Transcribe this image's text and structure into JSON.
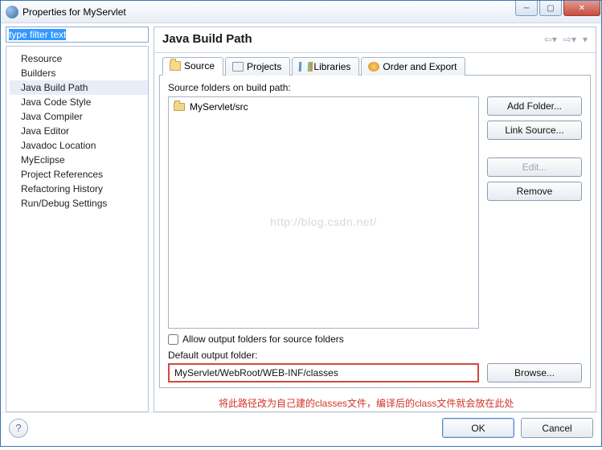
{
  "window": {
    "title": "Properties for MyServlet"
  },
  "sidebar": {
    "filter_placeholder": "type filter text",
    "items": [
      {
        "label": "Resource"
      },
      {
        "label": "Builders"
      },
      {
        "label": "Java Build Path"
      },
      {
        "label": "Java Code Style"
      },
      {
        "label": "Java Compiler"
      },
      {
        "label": "Java Editor"
      },
      {
        "label": "Javadoc Location"
      },
      {
        "label": "MyEclipse"
      },
      {
        "label": "Project References"
      },
      {
        "label": "Refactoring History"
      },
      {
        "label": "Run/Debug Settings"
      }
    ],
    "selected_index": 2
  },
  "main": {
    "heading": "Java Build Path",
    "tabs": [
      {
        "label": "Source"
      },
      {
        "label": "Projects"
      },
      {
        "label": "Libraries"
      },
      {
        "label": "Order and Export"
      }
    ],
    "active_tab": 0,
    "source_folders_label": "Source folders on build path:",
    "source_entries": [
      {
        "label": "MyServlet/src"
      }
    ],
    "buttons": {
      "add_folder": "Add Folder...",
      "link_source": "Link Source...",
      "edit": "Edit...",
      "remove": "Remove",
      "browse": "Browse..."
    },
    "allow_output_label": "Allow output folders for source folders",
    "allow_output_checked": false,
    "default_output_label": "Default output folder:",
    "default_output_value": "MyServlet/WebRoot/WEB-INF/classes",
    "watermark": "http://blog.csdn.net/"
  },
  "annotation": "将此路径改为自己建的classes文件，编译后的class文件就会放在此处",
  "footer": {
    "ok": "OK",
    "cancel": "Cancel"
  }
}
